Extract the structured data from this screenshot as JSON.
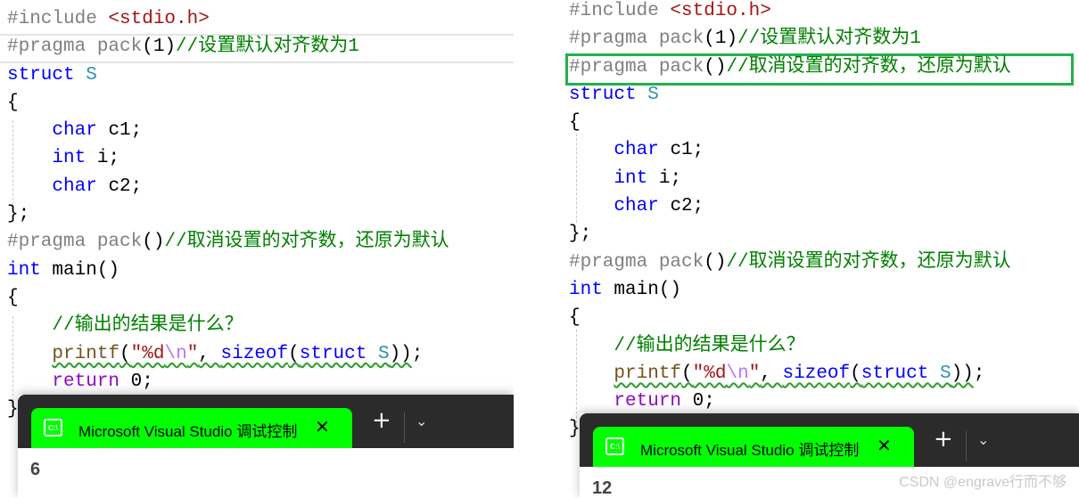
{
  "left": {
    "code": [
      [
        [
          "#include ",
          "pp"
        ],
        [
          "<stdio.h>",
          "inc"
        ]
      ],
      [
        [
          "#pragma pack",
          "pp"
        ],
        [
          "(1)",
          "pl"
        ],
        [
          "//设置默认对齐数为1",
          "cm"
        ]
      ],
      [
        [
          "struct ",
          "kw"
        ],
        [
          "S",
          "ty"
        ]
      ],
      [
        [
          "{",
          "pl"
        ]
      ],
      [
        [
          "    ",
          "pl"
        ],
        [
          "char",
          "kw"
        ],
        [
          " c1;",
          "pl"
        ]
      ],
      [
        [
          "    ",
          "pl"
        ],
        [
          "int",
          "kw"
        ],
        [
          " i;",
          "pl"
        ]
      ],
      [
        [
          "    ",
          "pl"
        ],
        [
          "char",
          "kw"
        ],
        [
          " c2;",
          "pl"
        ]
      ],
      [
        [
          "};",
          "pl"
        ]
      ],
      [
        [
          "#pragma pack",
          "pp"
        ],
        [
          "()",
          "pl"
        ],
        [
          "//取消设置的对齐数，还原为默认",
          "cm"
        ]
      ],
      [
        [
          "int",
          "kw"
        ],
        [
          " main()",
          "pl"
        ]
      ],
      [
        [
          "{",
          "pl"
        ]
      ],
      [
        [
          "    ",
          "pl"
        ],
        [
          "//输出的结果是什么？",
          "cm"
        ]
      ],
      [
        [
          "    ",
          "pl"
        ],
        [
          "printf",
          "fn sq"
        ],
        [
          "(",
          "pl sq"
        ],
        [
          "\"%d",
          "str sq"
        ],
        [
          "\\n",
          "esc sq"
        ],
        [
          "\"",
          "str sq"
        ],
        [
          ", ",
          "pl sq"
        ],
        [
          "sizeof",
          "kw sq"
        ],
        [
          "(",
          "pl sq"
        ],
        [
          "struct ",
          "kw sq"
        ],
        [
          "S",
          "ty sq"
        ],
        [
          "))",
          "pl sq"
        ],
        [
          ";",
          "pl"
        ]
      ],
      [
        [
          "    ",
          "pl"
        ],
        [
          "return",
          "ret"
        ],
        [
          " 0;",
          "pl"
        ]
      ],
      [
        [
          "}",
          "pl"
        ]
      ]
    ],
    "terminal": {
      "tab_title": "Microsoft Visual Studio 调试控制台",
      "output": "6"
    }
  },
  "right": {
    "code": [
      [
        [
          "#include ",
          "pp"
        ],
        [
          "<stdio.h>",
          "inc"
        ]
      ],
      [
        [
          "#pragma pack",
          "pp"
        ],
        [
          "(1)",
          "pl"
        ],
        [
          "//设置默认对齐数为1",
          "cm"
        ]
      ],
      [
        [
          "#pragma pack",
          "pp"
        ],
        [
          "()",
          "pl"
        ],
        [
          "//取消设置的对齐数，还原为默认",
          "cm"
        ]
      ],
      [
        [
          "struct ",
          "kw"
        ],
        [
          "S",
          "ty"
        ]
      ],
      [
        [
          "{",
          "pl"
        ]
      ],
      [
        [
          "    ",
          "pl"
        ],
        [
          "char",
          "kw"
        ],
        [
          " c1;",
          "pl"
        ]
      ],
      [
        [
          "    ",
          "pl"
        ],
        [
          "int",
          "kw"
        ],
        [
          " i;",
          "pl"
        ]
      ],
      [
        [
          "    ",
          "pl"
        ],
        [
          "char",
          "kw"
        ],
        [
          " c2;",
          "pl"
        ]
      ],
      [
        [
          "};",
          "pl"
        ]
      ],
      [
        [
          "#pragma pack",
          "pp"
        ],
        [
          "()",
          "pl"
        ],
        [
          "//取消设置的对齐数，还原为默认",
          "cm"
        ]
      ],
      [
        [
          "int",
          "kw"
        ],
        [
          " main()",
          "pl"
        ]
      ],
      [
        [
          "{",
          "pl"
        ]
      ],
      [
        [
          "    ",
          "pl"
        ],
        [
          "//输出的结果是什么？",
          "cm"
        ]
      ],
      [
        [
          "    ",
          "pl"
        ],
        [
          "printf",
          "fn sq"
        ],
        [
          "(",
          "pl sq"
        ],
        [
          "\"%d",
          "str sq"
        ],
        [
          "\\n",
          "esc sq"
        ],
        [
          "\"",
          "str sq"
        ],
        [
          ", ",
          "pl sq"
        ],
        [
          "sizeof",
          "kw sq"
        ],
        [
          "(",
          "pl sq"
        ],
        [
          "struct ",
          "kw sq"
        ],
        [
          "S",
          "ty sq"
        ],
        [
          "))",
          "pl sq"
        ],
        [
          ";",
          "pl"
        ]
      ],
      [
        [
          "    ",
          "pl"
        ],
        [
          "return",
          "ret"
        ],
        [
          " 0;",
          "pl"
        ]
      ],
      [
        [
          "}",
          "pl"
        ]
      ]
    ],
    "terminal": {
      "tab_title": "Microsoft Visual Studio 调试控制台",
      "output": "12"
    }
  },
  "terminal_common": {
    "icon": "C:\\",
    "close": "✕",
    "new_tab": "+",
    "dropdown": "⌄"
  },
  "highlight_color": "#22b14c",
  "watermark": "CSDN @engrave行而不够"
}
